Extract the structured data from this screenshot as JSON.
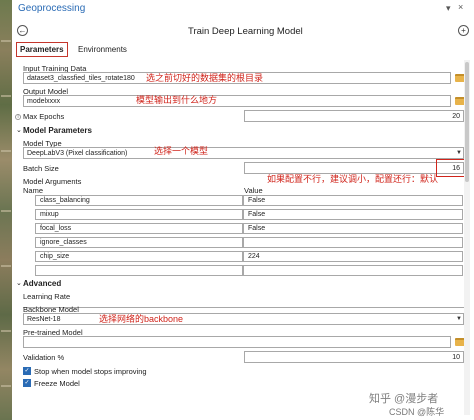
{
  "window": {
    "title": "Geoprocessing",
    "tool_title": "Train Deep Learning Model"
  },
  "icons": {
    "back": "back-arrow-icon",
    "forward": "forward-arrow-icon",
    "pin": "pin-icon",
    "close": "close-icon",
    "add": "add-icon",
    "folder": "folder-icon"
  },
  "tabs": [
    {
      "label": "Parameters"
    },
    {
      "label": "Environments"
    }
  ],
  "params": {
    "input_training_data": {
      "label": "Input Training Data",
      "value": "dataset3_classfied_tiles_rotate180",
      "annotation": "选之前切好的数据集的根目录"
    },
    "output_model": {
      "label": "Output Model",
      "value": "modelxxxx",
      "annotation": "模型输出到什么地方"
    },
    "max_epochs": {
      "label": "Max Epochs",
      "value": "20"
    }
  },
  "model_parameters": {
    "section_label": "Model Parameters",
    "model_type": {
      "label": "Model Type",
      "value": "DeepLabV3 (Pixel classification)",
      "annotation": "选择一个模型"
    },
    "batch_size": {
      "label": "Batch Size",
      "value": "16",
      "annotation": "如果配置不行，建议调小，配置还行：默认"
    },
    "model_arguments": {
      "label": "Model Arguments",
      "col_name": "Name",
      "col_value": "Value",
      "rows": [
        {
          "name": "class_balancing",
          "value": "False"
        },
        {
          "name": "mixup",
          "value": "False"
        },
        {
          "name": "focal_loss",
          "value": "False"
        },
        {
          "name": "ignore_classes",
          "value": ""
        },
        {
          "name": "chip_size",
          "value": "224"
        },
        {
          "name": "",
          "value": ""
        }
      ]
    }
  },
  "advanced": {
    "section_label": "Advanced",
    "learning_rate": {
      "label": "Learning Rate",
      "value": ""
    },
    "backbone_model": {
      "label": "Backbone Model",
      "value": "ResNet-18",
      "annotation": "选择网络的backbone"
    },
    "pretrained_model": {
      "label": "Pre-trained Model",
      "value": ""
    },
    "validation": {
      "label": "Validation %",
      "value": "10"
    },
    "stop_when_no_improve": {
      "label": "Stop when model stops improving",
      "checked": true
    },
    "freeze_model": {
      "label": "Freeze Model",
      "checked": true
    }
  },
  "watermarks": {
    "zhihu": "知乎 @漫步者",
    "csdn": "CSDN @陈华"
  }
}
